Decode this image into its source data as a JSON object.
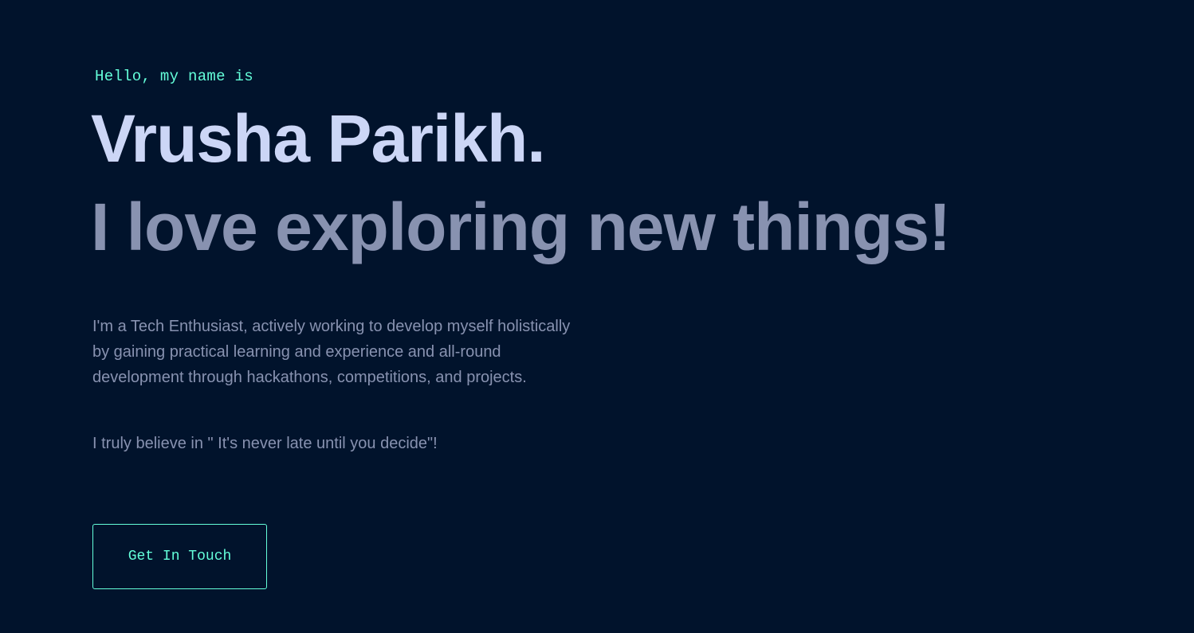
{
  "hero": {
    "greeting": "Hello, my name is",
    "name": "Vrusha Parikh.",
    "tagline": "I love exploring new things!",
    "bio": "I'm a Tech Enthusiast, actively working to develop myself holistically by gaining practical learning and experience and all-round development through hackathons, competitions, and projects.",
    "motto": "I truly believe in \" It's never late until you decide\"!",
    "cta_label": "Get In Touch"
  },
  "colors": {
    "background": "#01132c",
    "accent": "#64ffda",
    "heading": "#ccd6f6",
    "muted": "#8892b0"
  }
}
